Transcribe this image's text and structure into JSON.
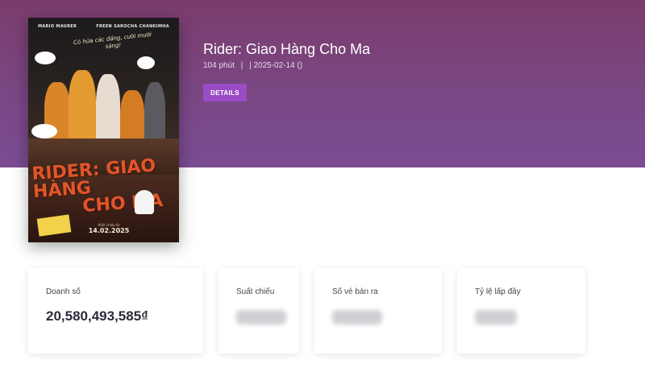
{
  "movie": {
    "title": "Rider: Giao Hàng Cho Ma",
    "duration": "104 phút",
    "separator": "|",
    "release": "| 2025-02-14 ()",
    "details_label": "DETAILS"
  },
  "poster": {
    "cast_1": "MARIO MAURER",
    "cast_2": "FREEN SAROCHA CHANKIMHA",
    "tagline": "Có hứa các đảng, cười mười sáng!",
    "title_line1": "RIDER: GIAO HÀNG",
    "title_line2": "CHO MA",
    "release_caption": "Khởi chiếu từ",
    "release_date": "14.02.2025"
  },
  "stats": [
    {
      "label": "Doanh số",
      "value": "20,580,493,585₫"
    },
    {
      "label": "Suất chiếu",
      "value": ""
    },
    {
      "label": "Số vé bán ra",
      "value": ""
    },
    {
      "label": "Tỷ lệ lấp đầy",
      "value": ""
    }
  ],
  "colors": {
    "hero_top": "#7a3c6c",
    "hero_bottom": "#7b4c93",
    "button": "#9a4cc4"
  }
}
